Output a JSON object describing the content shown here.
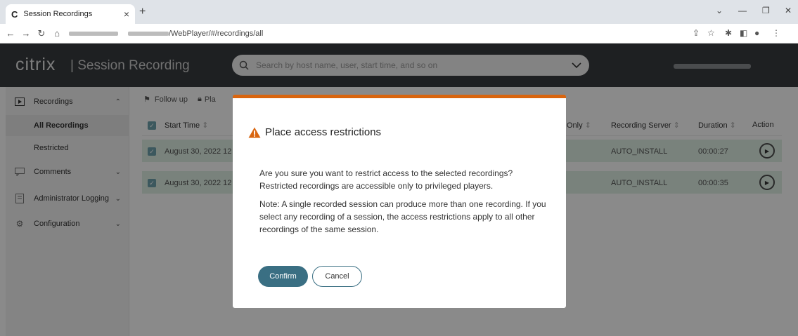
{
  "browser": {
    "tab_title": "Session Recordings",
    "favicon": "C",
    "url_path": "/WebPlayer/#/recordings/all",
    "new_tab": "+",
    "close_tab": "×"
  },
  "header": {
    "logo": "citrix",
    "product": "Session Recording",
    "search_placeholder": "Search by host name, user, start time, and so on"
  },
  "sidebar": {
    "recordings": "Recordings",
    "all_recordings": "All Recordings",
    "restricted": "Restricted",
    "comments": "Comments",
    "admin_logging": "Administrator Logging",
    "configuration": "Configuration"
  },
  "toolbar": {
    "follow_up": "Follow up",
    "place_partial": "Pla"
  },
  "table": {
    "columns": {
      "start_time": "Start Time",
      "only_partial": "Only",
      "recording_server": "Recording Server",
      "duration": "Duration",
      "action": "Action"
    },
    "rows": [
      {
        "start": "August 30, 2022 12",
        "server": "AUTO_INSTALL",
        "duration": "00:00:27"
      },
      {
        "start": "August 30, 2022 12",
        "server": "AUTO_INSTALL",
        "duration": "00:00:35"
      }
    ]
  },
  "modal": {
    "title": "Place access restrictions",
    "text1": "Are you sure you want to restrict access to the selected recordings? Restricted recordings are accessible only to privileged players.",
    "text2": "Note: A single recorded session can produce more than one recording. If you select any recording of a session, the access restrictions apply to all other recordings of the same session.",
    "confirm": "Confirm",
    "cancel": "Cancel"
  },
  "colors": {
    "accent": "#3a6f83",
    "warning": "#d9650f",
    "row_bg": "#dff0e6",
    "header_bg": "#393c40"
  }
}
